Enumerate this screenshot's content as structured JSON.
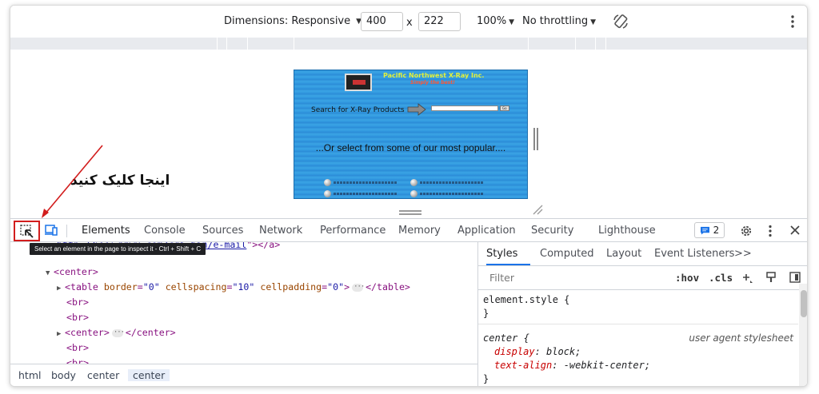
{
  "device_toolbar": {
    "dimensions_label": "Dimensions: Responsive",
    "width": "400",
    "times": "x",
    "height": "222",
    "zoom": "100%",
    "throttling": "No throttling"
  },
  "viewport_page": {
    "brand": "Pacific Northwest X-Ray Inc.",
    "tagline": "Simply the best!",
    "search_label": "Search for X-Ray Products",
    "search_button": "Go",
    "popular_text": "...Or select from some of our most popular...."
  },
  "annotation": {
    "text": "اینجا کلیک کنید"
  },
  "devtools": {
    "tabs": [
      "Elements",
      "Console",
      "Sources",
      "Network",
      "Performance",
      "Memory",
      "Application",
      "Security",
      "Lighthouse"
    ],
    "issues_count": "2",
    "inspect_tooltip": "Select an element in the page to inspect it - Ctrl + Shift + C"
  },
  "elements": {
    "line0_link": "http://www.pnwx.com/cgi-bin/e-mail",
    "line0_tail": "\"></a>",
    "line1": "<center>",
    "line2_tag": "<table",
    "line2_attr1": "border",
    "line2_val1": "\"0\"",
    "line2_attr2": "cellspacing",
    "line2_val2": "\"10\"",
    "line2_attr3": "cellpadding",
    "line2_val3": "\"0\"",
    "line2_close_open": ">",
    "line2_end": "</table>",
    "br": "<br>",
    "center_open": "<center>",
    "center_close": "</center>"
  },
  "breadcrumbs": [
    "html",
    "body",
    "center",
    "center"
  ],
  "styles": {
    "tabs": [
      "Styles",
      "Computed",
      "Layout",
      "Event Listeners"
    ],
    "more": ">>",
    "filter_placeholder": "Filter",
    "hov": ":hov",
    "cls": ".cls",
    "rule1_selector": "element.style {",
    "rule1_close": "}",
    "rule2_selector": "center {",
    "rule2_source": "user agent stylesheet",
    "rule2_prop1": "display",
    "rule2_val1": "block;",
    "rule2_prop2": "text-align",
    "rule2_val2": "-webkit-center;",
    "rule2_close": "}"
  },
  "colors": {
    "accent": "#1a73e8",
    "annotation_red": "#d21d1d"
  }
}
